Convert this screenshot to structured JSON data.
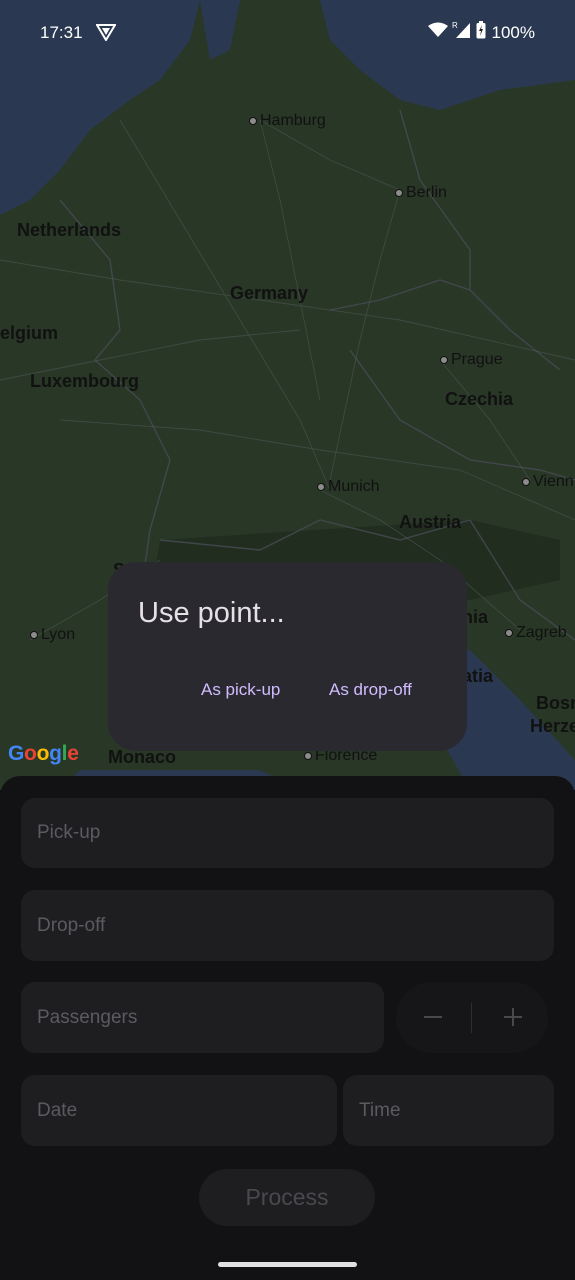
{
  "status_bar": {
    "time": "17:31",
    "battery": "100%"
  },
  "map": {
    "logo": "Google",
    "cities": [
      {
        "name": "Hamburg"
      },
      {
        "name": "Berlin"
      },
      {
        "name": "Prague"
      },
      {
        "name": "Munich"
      },
      {
        "name": "Vienn"
      },
      {
        "name": "Lyon"
      },
      {
        "name": "Zagreb"
      },
      {
        "name": "Florence"
      }
    ],
    "regions": [
      {
        "name": "Netherlands"
      },
      {
        "name": "Germany"
      },
      {
        "name": "elgium"
      },
      {
        "name": "Luxembourg"
      },
      {
        "name": "Czechia"
      },
      {
        "name": "Austria"
      },
      {
        "name": "nia"
      },
      {
        "name": "atia"
      },
      {
        "name": "Bosn"
      },
      {
        "name": "Herze"
      },
      {
        "name": "Monaco"
      },
      {
        "name": "S"
      }
    ]
  },
  "dialog": {
    "title": "Use point...",
    "pickup_action": "As pick-up",
    "dropoff_action": "As drop-off"
  },
  "form": {
    "pickup_placeholder": "Pick-up",
    "dropoff_placeholder": "Drop-off",
    "passengers_placeholder": "Passengers",
    "date_placeholder": "Date",
    "time_placeholder": "Time",
    "process_label": "Process"
  },
  "colors": {
    "accent": "#d0bcff",
    "dialog_bg": "#2b2930",
    "sheet_bg": "#121214",
    "field_bg": "#1e1e21"
  }
}
